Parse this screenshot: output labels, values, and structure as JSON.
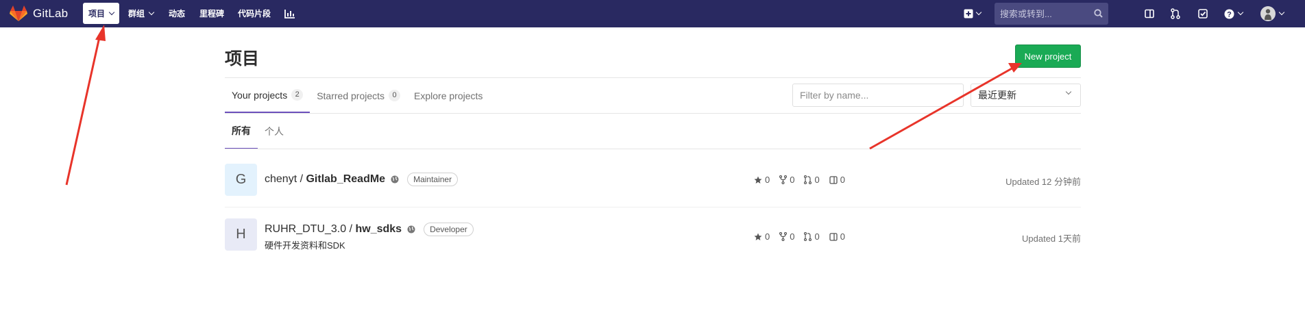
{
  "navbar": {
    "logo_text": "GitLab",
    "items": [
      {
        "label": "项目"
      },
      {
        "label": "群组"
      },
      {
        "label": "动态"
      },
      {
        "label": "里程碑"
      },
      {
        "label": "代码片段"
      }
    ],
    "search_placeholder": "搜索或转到..."
  },
  "page": {
    "title": "项目",
    "new_project_label": "New project"
  },
  "tabs": [
    {
      "label": "Your projects",
      "count": "2"
    },
    {
      "label": "Starred projects",
      "count": "0"
    },
    {
      "label": "Explore projects"
    }
  ],
  "filter": {
    "placeholder": "Filter by name...",
    "sort_value": "最近更新"
  },
  "subtabs": [
    {
      "label": "所有"
    },
    {
      "label": "个人"
    }
  ],
  "projects": [
    {
      "avatar_letter": "G",
      "namespace": "chenyt /",
      "name": "Gitlab_ReadMe",
      "role": "Maintainer",
      "description": "",
      "stars": "0",
      "forks": "0",
      "merge_requests": "0",
      "issues": "0",
      "updated": "Updated 12 分钟前"
    },
    {
      "avatar_letter": "H",
      "namespace": "RUHR_DTU_3.0 /",
      "name": "hw_sdks",
      "role": "Developer",
      "description": "硬件开发资料和SDK",
      "stars": "0",
      "forks": "0",
      "merge_requests": "0",
      "issues": "0",
      "updated": "Updated 1天前"
    }
  ],
  "colors": {
    "navbar_bg": "#292961",
    "new_project_btn": "#1aaa55",
    "active_tab_border": "#6b4fbb",
    "annotation_arrow": "#e8342a"
  }
}
